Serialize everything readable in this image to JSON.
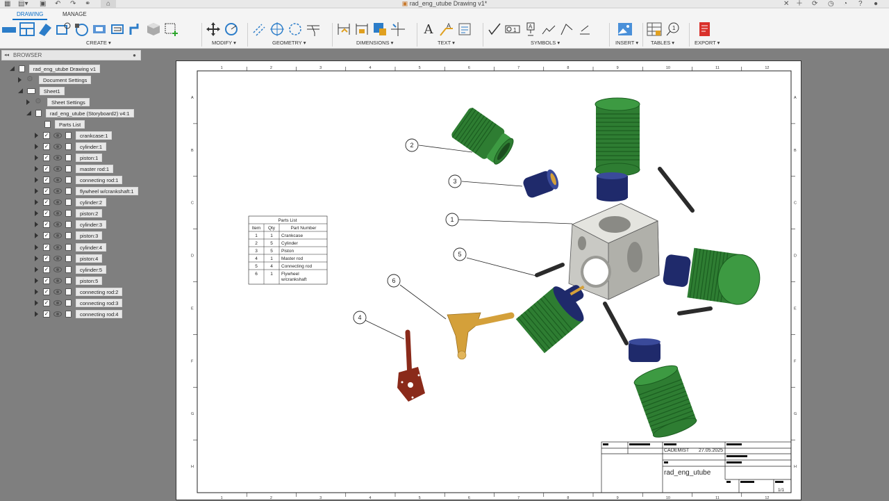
{
  "window": {
    "title": "rad_eng_utube Drawing v1*"
  },
  "tabs": [
    {
      "label": "DRAWING"
    },
    {
      "label": "MANAGE"
    }
  ],
  "ribbon": {
    "groups": [
      {
        "label": "CREATE ▾"
      },
      {
        "label": "MODIFY ▾"
      },
      {
        "label": "GEOMETRY ▾"
      },
      {
        "label": "DIMENSIONS ▾"
      },
      {
        "label": "TEXT ▾"
      },
      {
        "label": "SYMBOLS ▾"
      },
      {
        "label": "INSERT ▾"
      },
      {
        "label": "TABLES ▾"
      },
      {
        "label": "EXPORT ▾"
      }
    ]
  },
  "browser": {
    "title": "BROWSER",
    "root": "rad_eng_utube Drawing v1",
    "doc_settings": "Document Settings",
    "sheet": "Sheet1",
    "sheet_settings": "Sheet Settings",
    "view": "rad_eng_utube (Storyboard2) v4:1",
    "parts_list": "Parts List",
    "components": [
      "crankcase:1",
      "cylinder:1",
      "piston:1",
      "master rod:1",
      "connecting rod:1",
      "flywheel w/crankshaft:1",
      "cylinder:2",
      "piston:2",
      "cylinder:3",
      "piston:3",
      "cylinder:4",
      "piston:4",
      "cylinder:5",
      "piston:5",
      "connecting rod:2",
      "connecting rod:3",
      "connecting rod:4"
    ]
  },
  "drawing": {
    "border_columns": [
      "1",
      "2",
      "3",
      "4",
      "5",
      "6",
      "7",
      "8",
      "9",
      "10",
      "11",
      "12"
    ],
    "border_rows": [
      "A",
      "B",
      "C",
      "D",
      "E",
      "F",
      "G",
      "H"
    ],
    "parts_list": {
      "title": "Parts List",
      "headers": [
        "Item",
        "Qty",
        "Part Number"
      ],
      "rows": [
        [
          "1",
          "1",
          "Crankcase"
        ],
        [
          "2",
          "5",
          "Cylinder"
        ],
        [
          "3",
          "5",
          "Piston"
        ],
        [
          "4",
          "1",
          "Master rod"
        ],
        [
          "5",
          "4",
          "Connecting rod"
        ],
        [
          "6",
          "1",
          "Flywheel w/crankshaft"
        ]
      ]
    },
    "balloons": [
      "1",
      "2",
      "3",
      "4",
      "5",
      "6"
    ],
    "title_block": {
      "author": "CADEMIST",
      "date": "27.05.2025",
      "title": "rad_eng_utube",
      "sheet": "1/1"
    }
  },
  "colors": {
    "accent": "#0b6ec7",
    "cylinder": "#2e7d32",
    "piston": "#1f2a6b",
    "crankcase": "#c9c9c4",
    "flywheel": "#d4a03a",
    "master_rod": "#8a2a1a",
    "rod": "#2b2b2b"
  }
}
